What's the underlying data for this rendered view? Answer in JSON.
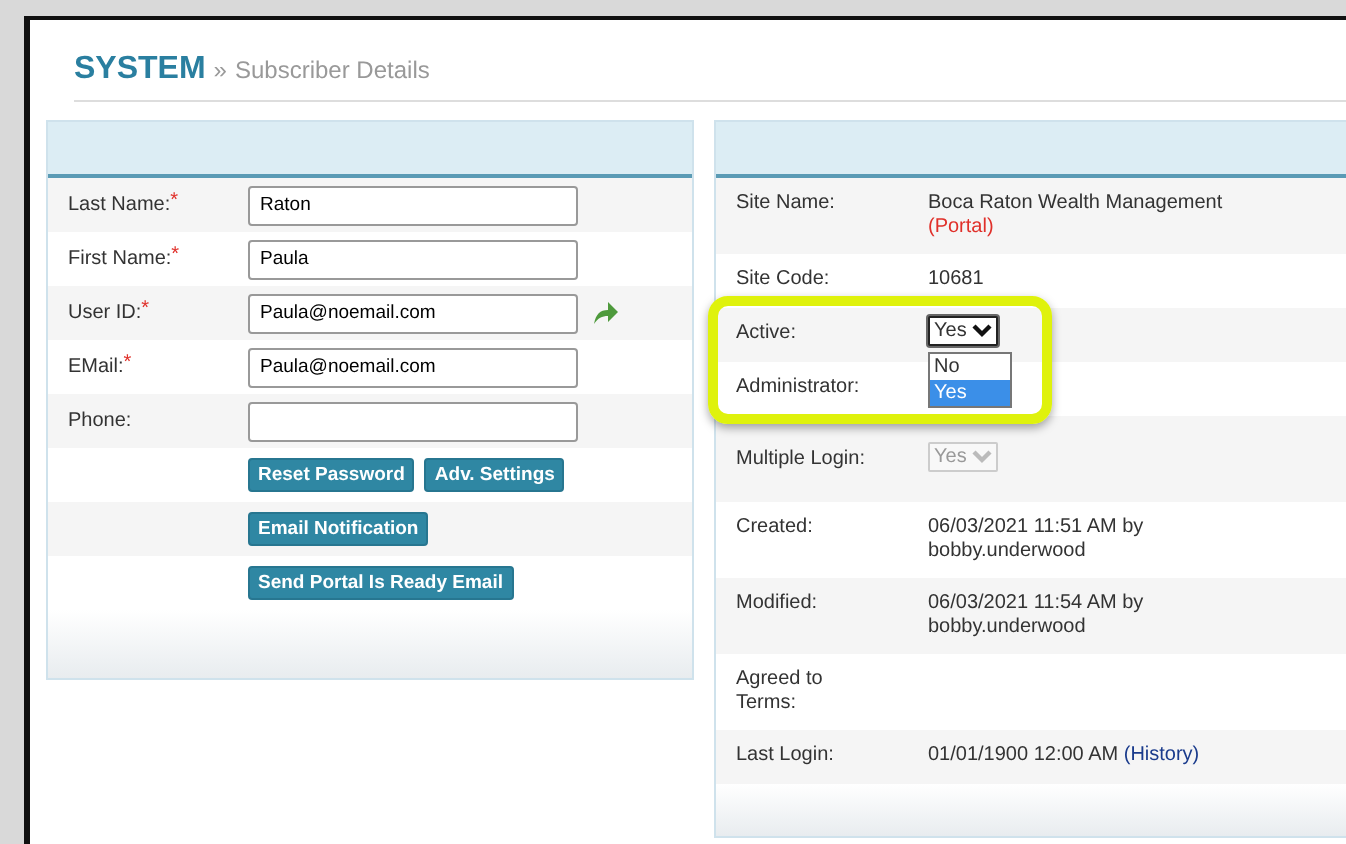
{
  "header": {
    "section": "SYSTEM",
    "separator": "»",
    "page": "Subscriber Details"
  },
  "subscriber_form": {
    "fields": [
      {
        "kind": "text",
        "label": "Last Name:",
        "required_mark": "*",
        "value": "Raton"
      },
      {
        "kind": "text",
        "label": "First Name:",
        "required_mark": "*",
        "value": "Paula"
      },
      {
        "kind": "text_with_action",
        "label": "User ID:",
        "required_mark": "*",
        "value": "Paula@noemail.com"
      },
      {
        "kind": "text",
        "label": "EMail:",
        "required_mark": "*",
        "value": "Paula@noemail.com"
      },
      {
        "kind": "text",
        "label": "Phone:"
      }
    ],
    "button_rows": [
      [
        {
          "label": "Reset Password"
        },
        {
          "label": "Adv. Settings"
        }
      ],
      [
        {
          "label": "Email Notification"
        }
      ],
      [
        {
          "label": "Send Portal Is Ready Email"
        }
      ]
    ]
  },
  "site_details": {
    "rows": [
      {
        "kind": "text",
        "label": "Site Name:",
        "value": "Boca Raton Wealth Management",
        "note": "(Portal)",
        "highlighted": false
      },
      {
        "kind": "text",
        "label": "Site Code:",
        "value": "10681",
        "highlighted": false
      },
      {
        "kind": "select",
        "label": "Active:",
        "value": "Yes",
        "disabled": false,
        "expanded": true,
        "options": [
          {
            "label": "No",
            "selected": false
          },
          {
            "label": "Yes",
            "selected": true
          }
        ],
        "highlighted": true
      },
      {
        "kind": "label",
        "label": "Administrator:",
        "highlighted": true
      },
      {
        "kind": "select",
        "label": "Multiple Login:",
        "value": "Yes",
        "disabled": true,
        "expanded": false,
        "highlighted": false
      },
      {
        "kind": "text",
        "label": "Created:",
        "value": "06/03/2021 11:51 AM by bobby.underwood",
        "highlighted": false
      },
      {
        "kind": "text",
        "label": "Modified:",
        "value": "06/03/2021 11:54 AM by bobby.underwood",
        "highlighted": false
      },
      {
        "kind": "label",
        "label": "Agreed to Terms:",
        "highlighted": false
      },
      {
        "kind": "text",
        "label": "Last Login:",
        "value": "01/01/1900 12:00 AM",
        "link": "(History)",
        "highlighted": false
      }
    ]
  }
}
